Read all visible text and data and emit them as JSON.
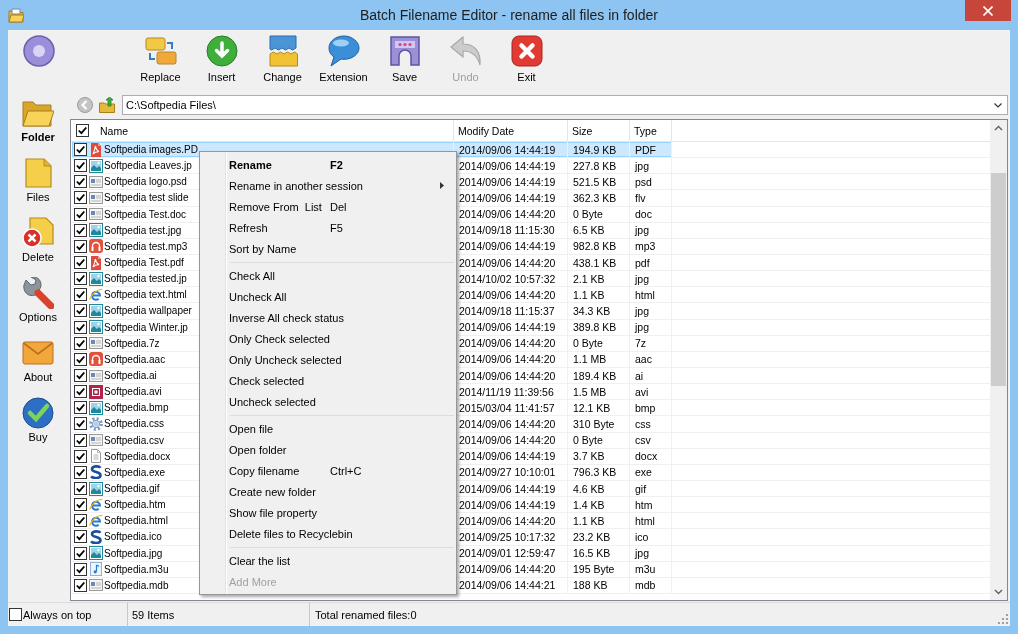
{
  "window": {
    "title": "Batch Filename Editor - rename all files in folder"
  },
  "toolbar": [
    {
      "kind": "disc",
      "disabled": false
    },
    {
      "kind": "replace",
      "label": "Replace",
      "disabled": false
    },
    {
      "kind": "insert",
      "label": "Insert",
      "disabled": false
    },
    {
      "kind": "change",
      "label": "Change",
      "disabled": false
    },
    {
      "kind": "extension",
      "label": "Extension",
      "disabled": false
    },
    {
      "kind": "save",
      "label": "Save",
      "disabled": false
    },
    {
      "kind": "undo",
      "label": "Undo",
      "disabled": true
    },
    {
      "kind": "exit",
      "label": "Exit",
      "disabled": false
    }
  ],
  "sidebar": {
    "items": [
      {
        "kind": "folder",
        "label": "Folder",
        "selected": true
      },
      {
        "kind": "files",
        "label": "Files",
        "selected": false
      },
      {
        "kind": "delete",
        "label": "Delete",
        "selected": false
      },
      {
        "kind": "options",
        "label": "Options",
        "selected": false
      },
      {
        "kind": "about",
        "label": "About",
        "selected": false
      },
      {
        "kind": "buy",
        "label": "Buy",
        "selected": false
      }
    ]
  },
  "path_bar": {
    "value": "C:\\Softpedia Files\\"
  },
  "table": {
    "check_all": true,
    "columns": [
      "Name",
      "Modify Date",
      "Size",
      "Type"
    ],
    "rows": [
      {
        "kind": "pdf",
        "name": "Softpedia images.PD",
        "date": "2014/09/06 14:44:19",
        "size": "194.9 KB",
        "type": "PDF",
        "checked": true,
        "selected": true
      },
      {
        "kind": "image",
        "name": "Softpedia Leaves.jp",
        "date": "2014/09/06 14:44:19",
        "size": "227.8 KB",
        "type": "jpg",
        "checked": true,
        "selected": false
      },
      {
        "kind": "window",
        "name": "Softpedia logo.psd",
        "date": "2014/09/06 14:44:19",
        "size": "521.5 KB",
        "type": "psd",
        "checked": true,
        "selected": false
      },
      {
        "kind": "window",
        "name": "Softpedia test slide",
        "date": "2014/09/06 14:44:19",
        "size": "362.3 KB",
        "type": "flv",
        "checked": true,
        "selected": false
      },
      {
        "kind": "window",
        "name": "Softpedia Test.doc",
        "date": "2014/09/06 14:44:20",
        "size": "0 Byte",
        "type": "doc",
        "checked": true,
        "selected": false
      },
      {
        "kind": "image",
        "name": "Softpedia test.jpg",
        "date": "2014/09/18 11:15:30",
        "size": "6.5 KB",
        "type": "jpg",
        "checked": true,
        "selected": false
      },
      {
        "kind": "audio",
        "name": "Softpedia test.mp3",
        "date": "2014/09/06 14:44:19",
        "size": "982.8 KB",
        "type": "mp3",
        "checked": true,
        "selected": false
      },
      {
        "kind": "pdf",
        "name": "Softpedia Test.pdf",
        "date": "2014/09/06 14:44:20",
        "size": "438.1 KB",
        "type": "pdf",
        "checked": true,
        "selected": false
      },
      {
        "kind": "image",
        "name": "Softpedia tested.jp",
        "date": "2014/10/02 10:57:32",
        "size": "2.1 KB",
        "type": "jpg",
        "checked": true,
        "selected": false
      },
      {
        "kind": "web",
        "name": "Softpedia text.html",
        "date": "2014/09/06 14:44:20",
        "size": "1.1 KB",
        "type": "html",
        "checked": true,
        "selected": false
      },
      {
        "kind": "image",
        "name": "Softpedia wallpaper",
        "date": "2014/09/18 11:15:37",
        "size": "34.3 KB",
        "type": "jpg",
        "checked": true,
        "selected": false
      },
      {
        "kind": "image",
        "name": "Softpedia Winter.jp",
        "date": "2014/09/06 14:44:19",
        "size": "389.8 KB",
        "type": "jpg",
        "checked": true,
        "selected": false
      },
      {
        "kind": "window",
        "name": "Softpedia.7z",
        "date": "2014/09/06 14:44:20",
        "size": "0 Byte",
        "type": "7z",
        "checked": true,
        "selected": false
      },
      {
        "kind": "audio",
        "name": "Softpedia.aac",
        "date": "2014/09/06 14:44:20",
        "size": "1.1 MB",
        "type": "aac",
        "checked": true,
        "selected": false
      },
      {
        "kind": "window",
        "name": "Softpedia.ai",
        "date": "2014/09/06 14:44:20",
        "size": "189.4 KB",
        "type": "ai",
        "checked": true,
        "selected": false
      },
      {
        "kind": "video",
        "name": "Softpedia.avi",
        "date": "2014/11/19 11:39:56",
        "size": "1.5 MB",
        "type": "avi",
        "checked": true,
        "selected": false
      },
      {
        "kind": "image",
        "name": "Softpedia.bmp",
        "date": "2015/03/04 11:41:57",
        "size": "12.1 KB",
        "type": "bmp",
        "checked": true,
        "selected": false
      },
      {
        "kind": "gear",
        "name": "Softpedia.css",
        "date": "2014/09/06 14:44:20",
        "size": "310 Byte",
        "type": "css",
        "checked": true,
        "selected": false
      },
      {
        "kind": "window",
        "name": "Softpedia.csv",
        "date": "2014/09/06 14:44:20",
        "size": "0 Byte",
        "type": "csv",
        "checked": true,
        "selected": false
      },
      {
        "kind": "page",
        "name": "Softpedia.docx",
        "date": "2014/09/06 14:44:19",
        "size": "3.7 KB",
        "type": "docx",
        "checked": true,
        "selected": false
      },
      {
        "kind": "app",
        "name": "Softpedia.exe",
        "date": "2014/09/27 10:10:01",
        "size": "796.3 KB",
        "type": "exe",
        "checked": true,
        "selected": false
      },
      {
        "kind": "image",
        "name": "Softpedia.gif",
        "date": "2014/09/06 14:44:19",
        "size": "4.6 KB",
        "type": "gif",
        "checked": true,
        "selected": false
      },
      {
        "kind": "web",
        "name": "Softpedia.htm",
        "date": "2014/09/06 14:44:19",
        "size": "1.4 KB",
        "type": "htm",
        "checked": true,
        "selected": false
      },
      {
        "kind": "web",
        "name": "Softpedia.html",
        "date": "2014/09/06 14:44:20",
        "size": "1.1 KB",
        "type": "html",
        "checked": true,
        "selected": false
      },
      {
        "kind": "app",
        "name": "Softpedia.ico",
        "date": "2014/09/25 10:17:32",
        "size": "23.2 KB",
        "type": "ico",
        "checked": true,
        "selected": false
      },
      {
        "kind": "image",
        "name": "Softpedia.jpg",
        "date": "2014/09/01 12:59:47",
        "size": "16.5 KB",
        "type": "jpg",
        "checked": true,
        "selected": false
      },
      {
        "kind": "music",
        "name": "Softpedia.m3u",
        "date": "2014/09/06 14:44:20",
        "size": "195 Byte",
        "type": "m3u",
        "checked": true,
        "selected": false
      },
      {
        "kind": "window",
        "name": "Softpedia.mdb",
        "date": "2014/09/06 14:44:21",
        "size": "188 KB",
        "type": "mdb",
        "checked": true,
        "selected": false
      }
    ]
  },
  "context_menu": {
    "groups": [
      {
        "items": [
          {
            "label": "Rename",
            "shortcut": "F2",
            "default": true,
            "disabled": false,
            "submenu": false
          },
          {
            "label": "Rename in another session",
            "default": false,
            "disabled": false,
            "submenu": true
          },
          {
            "label": "Remove From  List",
            "shortcut": "Del",
            "default": false,
            "disabled": false,
            "submenu": false
          },
          {
            "label": "Refresh",
            "shortcut": "F5",
            "default": false,
            "disabled": false,
            "submenu": false
          },
          {
            "label": "Sort by Name",
            "default": false,
            "disabled": false,
            "submenu": false
          }
        ]
      },
      {
        "items": [
          {
            "label": "Check All",
            "default": false,
            "disabled": false,
            "submenu": false
          },
          {
            "label": "Uncheck All",
            "default": false,
            "disabled": false,
            "submenu": false
          },
          {
            "label": "Inverse All check status",
            "default": false,
            "disabled": false,
            "submenu": false
          },
          {
            "label": "Only Check selected",
            "default": false,
            "disabled": false,
            "submenu": false
          },
          {
            "label": "Only Uncheck selected",
            "default": false,
            "disabled": false,
            "submenu": false
          },
          {
            "label": "Check selected",
            "default": false,
            "disabled": false,
            "submenu": false
          },
          {
            "label": "Uncheck selected",
            "default": false,
            "disabled": false,
            "submenu": false
          }
        ]
      },
      {
        "items": [
          {
            "label": "Open file",
            "default": false,
            "disabled": false,
            "submenu": false
          },
          {
            "label": "Open folder",
            "default": false,
            "disabled": false,
            "submenu": false
          },
          {
            "label": "Copy filename",
            "shortcut": "Ctrl+C",
            "default": false,
            "disabled": false,
            "submenu": false
          },
          {
            "label": "Create new folder",
            "default": false,
            "disabled": false,
            "submenu": false
          },
          {
            "label": "Show file property",
            "default": false,
            "disabled": false,
            "submenu": false
          },
          {
            "label": "Delete files to Recyclebin",
            "default": false,
            "disabled": false,
            "submenu": false
          }
        ]
      },
      {
        "items": [
          {
            "label": "Clear the list",
            "default": false,
            "disabled": false,
            "submenu": false
          },
          {
            "label": "Add More",
            "default": false,
            "disabled": true,
            "submenu": false
          }
        ]
      }
    ]
  },
  "status_bar": {
    "always_on_top": {
      "label": "Always on top",
      "checked": false
    },
    "item_count": "59 Items",
    "renamed_total": "Total renamed files:0"
  }
}
